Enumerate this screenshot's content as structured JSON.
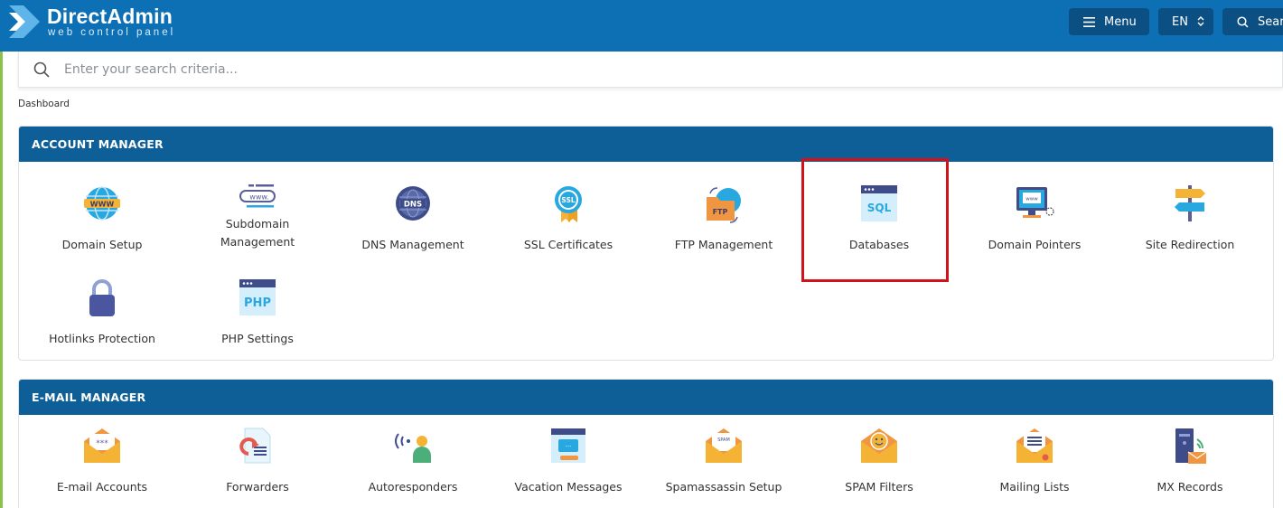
{
  "header": {
    "brand_title": "DirectAdmin",
    "brand_subtitle": "web control panel",
    "menu_label": "Menu",
    "language": "EN",
    "search_label": "Sear"
  },
  "search": {
    "placeholder": "Enter your search criteria..."
  },
  "breadcrumb": "Dashboard",
  "account_manager": {
    "title": "ACCOUNT MANAGER",
    "items": [
      {
        "label": "Domain Setup",
        "icon": "www-globe-icon"
      },
      {
        "label": "Subdomain Management",
        "icon": "subdomain-icon"
      },
      {
        "label": "DNS Management",
        "icon": "dns-globe-icon"
      },
      {
        "label": "SSL Certificates",
        "icon": "ssl-badge-icon"
      },
      {
        "label": "FTP Management",
        "icon": "ftp-folder-icon"
      },
      {
        "label": "Databases",
        "icon": "sql-database-icon"
      },
      {
        "label": "Domain Pointers",
        "icon": "monitor-www-icon"
      },
      {
        "label": "Site Redirection",
        "icon": "signpost-icon"
      },
      {
        "label": "Hotlinks Protection",
        "icon": "padlock-icon"
      },
      {
        "label": "PHP Settings",
        "icon": "php-window-icon"
      }
    ]
  },
  "email_manager": {
    "title": "E-MAIL MANAGER",
    "items": [
      {
        "label": "E-mail Accounts",
        "icon": "envelope-password-icon"
      },
      {
        "label": "Forwarders",
        "icon": "forward-document-icon"
      },
      {
        "label": "Autoresponders",
        "icon": "auto-reply-person-icon"
      },
      {
        "label": "Vacation Messages",
        "icon": "vacation-calendar-icon"
      },
      {
        "label": "Spamassassin Setup",
        "icon": "spam-envelope-icon"
      },
      {
        "label": "SPAM Filters",
        "icon": "smiley-envelope-icon"
      },
      {
        "label": "Mailing Lists",
        "icon": "mailing-list-icon"
      },
      {
        "label": "MX Records",
        "icon": "mx-server-icon"
      }
    ]
  },
  "colors": {
    "header_bg": "#0e70b4",
    "panel_header_bg": "#0e5f97",
    "highlight_box": "#d0131b",
    "left_accent": "#8bc34a"
  }
}
